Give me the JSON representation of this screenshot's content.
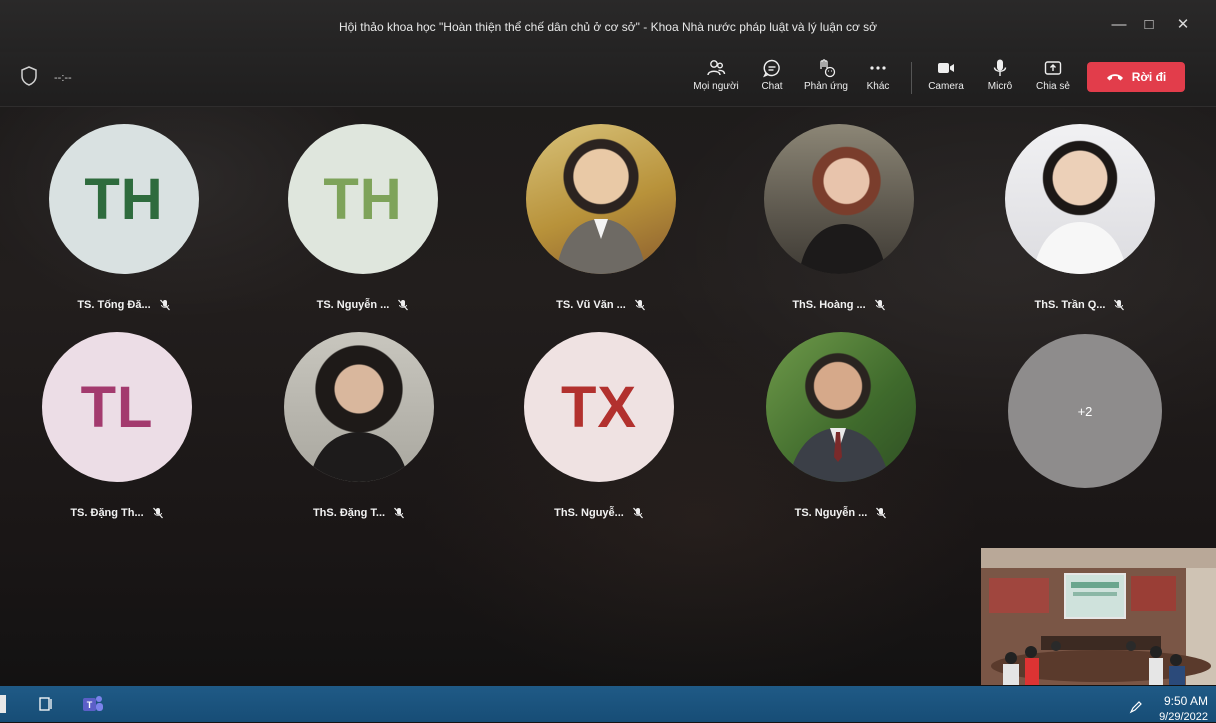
{
  "window": {
    "title": "Hội thảo khoa học \"Hoàn thiện thể chế dân chủ ở cơ sở\" - Khoa Nhà nước pháp luật và lý luận cơ sở"
  },
  "toolbar": {
    "timer": "--:--",
    "buttons": [
      {
        "label": "Mọi người",
        "icon": "people-icon"
      },
      {
        "label": "Chat",
        "icon": "chat-icon"
      },
      {
        "label": "Phản ứng",
        "icon": "reaction-icon"
      },
      {
        "label": "Khác",
        "icon": "more-icon"
      },
      {
        "label": "Camera",
        "icon": "camera-icon"
      },
      {
        "label": "Micrô",
        "icon": "mic-icon"
      },
      {
        "label": "Chia sẻ",
        "icon": "share-icon"
      }
    ],
    "leave_label": "Rời đi"
  },
  "participants": [
    {
      "name": "TS. Tống Đă...",
      "initials": "TH",
      "avatar_bg": "#d9e1e1",
      "initials_color": "#2e6b3d",
      "muted": true
    },
    {
      "name": "TS. Nguyễn ...",
      "initials": "TH",
      "avatar_bg": "#dfe6dd",
      "initials_color": "#7ea35a",
      "muted": true
    },
    {
      "name": "TS. Vũ Văn ...",
      "initials": "",
      "avatar_bg": "#b89b45",
      "muted": true
    },
    {
      "name": "ThS. Hoàng ...",
      "initials": "",
      "avatar_bg": "#6e6a60",
      "muted": true
    },
    {
      "name": "ThS. Trần Q...",
      "initials": "",
      "avatar_bg": "#e9e9ec",
      "muted": true
    },
    {
      "name": "TS. Đặng Th...",
      "initials": "TL",
      "avatar_bg": "#ecdde6",
      "initials_color": "#a33a6e",
      "muted": true
    },
    {
      "name": "ThS. Đặng T...",
      "initials": "",
      "avatar_bg": "#bcbab2",
      "muted": true
    },
    {
      "name": "ThS. Nguyễ...",
      "initials": "TX",
      "avatar_bg": "#efe2e2",
      "initials_color": "#b2312e",
      "muted": true
    },
    {
      "name": "TS. Nguyễn ...",
      "initials": "",
      "avatar_bg": "#4f7a3c",
      "muted": true
    }
  ],
  "overflow": {
    "label": "+2"
  },
  "taskbar": {
    "time": "9:50 AM",
    "date": "9/29/2022"
  },
  "colors": {
    "leave": "#e23d4b",
    "taskbar": "#1f5a86",
    "titlebar": "#2a2929"
  }
}
